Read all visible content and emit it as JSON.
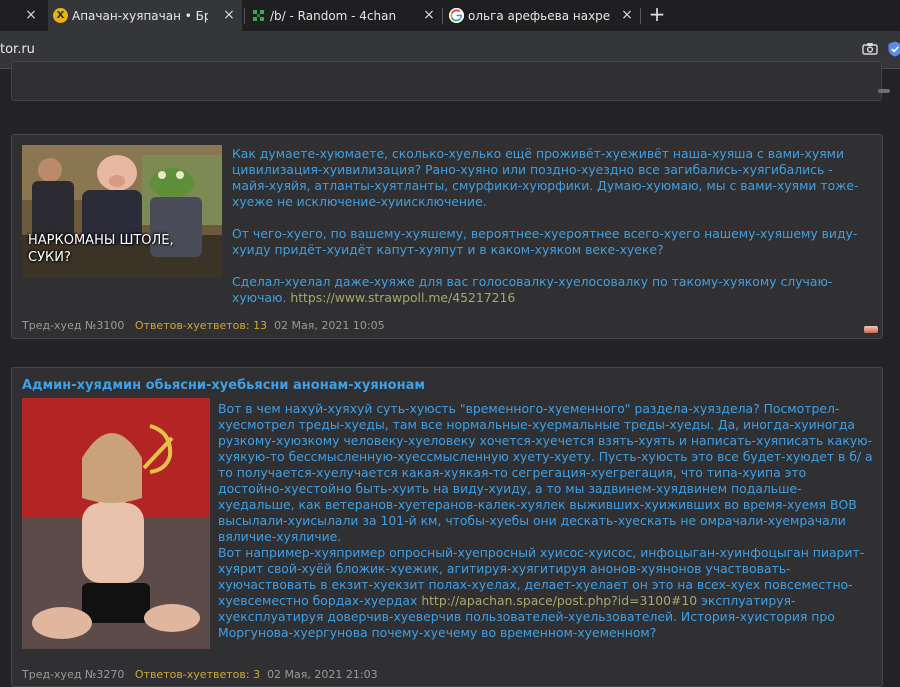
{
  "browser": {
    "tabs": [
      {
        "title": "Апачан-хуяпачан • Бред-х",
        "active": true,
        "favicon": "x-icon"
      },
      {
        "title": "/b/ - Random - 4chan",
        "active": false,
        "favicon": "4chan-clover-icon"
      },
      {
        "title": "ольга арефьева нахрена н",
        "active": false,
        "favicon": "google-icon"
      }
    ],
    "first_tab_close": "×",
    "new_tab_label": "+",
    "url": "tor.ru"
  },
  "posts": [
    {
      "title": "",
      "image_caption": "НАРКОМАНЫ ШТОЛЕ,\nСУКИ?",
      "paragraphs": [
        "Как думаете-хуюмаете, сколько-хуелько ещё проживёт-хуеживёт наша-хуяша с вами-хуями цивилизация-хуивилизация? Рано-хуяно или поздно-хуездно все загибались-хуягибались - майя-хуяйя, атланты-хуятланты, смурфики-хуюрфики. Думаю-хуюмаю, мы с вами-хуями тоже-хуеже не исключение-хуиисключение.",
        "От чего-хуего, по вашему-хуяшему, вероятнее-хуероятнее всего-хуего нашему-хуяшему виду-хуиду придёт-хуидёт капут-хуяпут и в каком-хуяком веке-хуеке?",
        "Сделал-хуелал даже-хуяже для вас голосовалку-хуелосовалку по такому-хуякому случаю-хуючаю."
      ],
      "link": "https://www.strawpoll.me/45217216",
      "footer": {
        "thread": "Тред-хуед №3100",
        "replies_label": "Ответов-хуетветов:",
        "replies_count": "13",
        "date": "02 Мая, 2021 10:05"
      }
    },
    {
      "title": "Админ-хуядмин обьясни-хуебьясни анонам-хуянонам",
      "paragraphs": [
        "Вот в чем нахуй-хуяхуй суть-хуюсть \"временного-хуеменного\" раздела-хуяздела? Посмотрел-хуесмотрел треды-хуеды, там все нормальные-хуермальные треды-хуеды. Да, иногда-хуиногда рузкому-хуюзкому человеку-хуеловеку хочется-хуечется взять-хуять и написать-хуяписать какую-хуякую-то бессмысленную-хуессмысленную хуету-хуету. Пусть-хуюсть это все будет-хуюдет в б/ а то получается-хуелучается какая-хуякая-то сегрегация-хуегрегация, что типа-хуипа это достойно-хуестойно быть-хуить на виду-хуиду, а то мы задвинем-хуядвинем подальше-хуедальше, как ветеранов-хуетеранов-калек-хуялек выживших-хуиживших во время-хуемя ВОВ высылали-хуисылали за 101-й км, чтобы-хуебы они дескать-хуескать не омрачали-хуемрачали вяличие-хуяличие.",
        "Вот например-хуяпример опросный-хуепросный хуисос-хуисос, инфоцыган-хуинфоцыган пиарит-хуярит свой-хуёй бложик-хуежик, агитируя-хуягитируя анонов-хуянонов участвовать-хуючаствовать в екзит-хуекзит полах-хуелах, делает-хуелает он это на всех-хуех повсеместно-хуевсеместно бордах-хуердах"
      ],
      "link": "http://apachan.space/post.php?id=3100#10",
      "after_link": "эксплуатируя-хуексплуатируя доверчив-хуеверчив пользователей-хуельзователей. История-хуистория про Моргунова-хуергунова почему-хуечему во временном-хуеменном?",
      "footer": {
        "thread": "Тред-хуед №3270",
        "replies_label": "Ответов-хуетветов:",
        "replies_count": "3",
        "date": "02 Мая, 2021 21:03"
      }
    }
  ],
  "colors": {
    "page_bg": "#232325",
    "post_bg": "#303032",
    "text_blue": "#3ea0e6",
    "link_olive": "#a9a86a",
    "reply_orange": "#d2a53a"
  }
}
